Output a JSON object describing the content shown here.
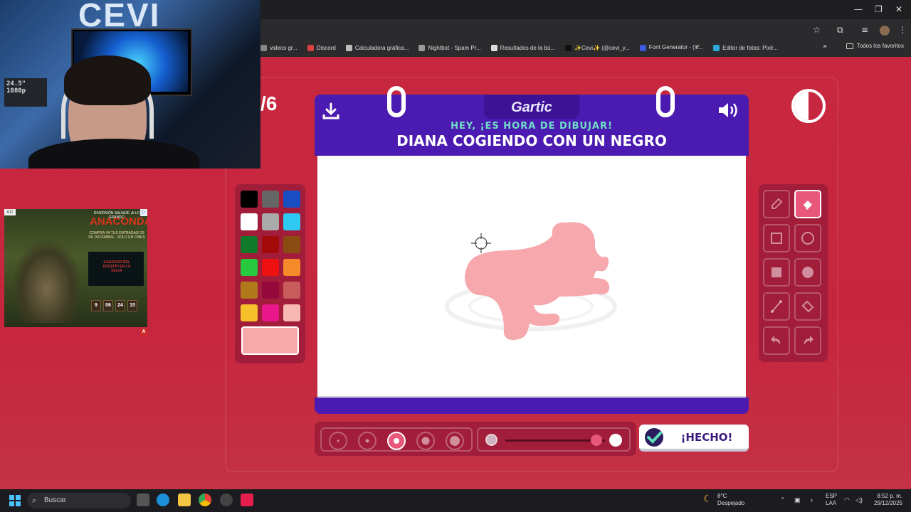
{
  "browser": {
    "bookmarks": [
      {
        "label": "videos gr...",
        "color": "#888888"
      },
      {
        "label": "Discord",
        "color": "#d84040"
      },
      {
        "label": "Calculadora gráfica...",
        "color": "#bbbbbb"
      },
      {
        "label": "Nightbot - Spam Pr...",
        "color": "#999999"
      },
      {
        "label": "Resultados de la bú...",
        "color": "#dddddd"
      },
      {
        "label": "✨Cevi✨ (@cevi_y...",
        "color": "#111111"
      },
      {
        "label": "Font Generator - (𝓒...",
        "color": "#3b5ad9"
      },
      {
        "label": "Editor de fotos: Pixlr...",
        "color": "#2aa8d8"
      }
    ],
    "all_favorites": "Todos los favoritos"
  },
  "webcam": {
    "sign_text": "CEVI",
    "monitor_label": "24.5\" 1080p"
  },
  "ad": {
    "tag": "AD",
    "sub": "DIVERSIÓN SALVAJE ¡A LO GRANDE!",
    "title": "ANACONDA",
    "cta": "COMPRA YA TUS ENTRADAS! 25 DE DICIEMBRE - SOLO EN CINES",
    "video_text": "GANADOR DEL DESAFÍO EN LA SELVA",
    "countdown": [
      "9",
      "06",
      "24",
      "15"
    ]
  },
  "game": {
    "round": "/6",
    "logo": "Gartic",
    "hey_text": "HEY, ¡ES HORA DE DIBUJAR!",
    "word": "DIANA COGIENDO CON UN NEGRO",
    "done_label": "¡HECHO!",
    "selected_color": "#f7a9a9",
    "selected_size_index": 2,
    "palette": [
      "#000000",
      "#666666",
      "#1a4fc4",
      "#ffffff",
      "#aaaaaa",
      "#2ec9f0",
      "#117a2a",
      "#a30a0a",
      "#8a4c10",
      "#27c93f",
      "#ee1111",
      "#f58a2a",
      "#b07a1a",
      "#96093c",
      "#c85c5c",
      "#f5c02a",
      "#e8178a",
      "#f7b8b4"
    ],
    "tools": [
      "pencil",
      "eraser",
      "rectangle",
      "ellipse",
      "filled-rectangle",
      "filled-ellipse",
      "line",
      "fill-bucket",
      "undo",
      "redo"
    ],
    "active_tool": "eraser"
  },
  "taskbar": {
    "search_placeholder": "Buscar",
    "weather_temp": "8°C",
    "weather_desc": "Despejado",
    "lang": "ESP",
    "lang2": "LAA",
    "time": "8:52 p. m.",
    "date": "29/12/2025"
  }
}
